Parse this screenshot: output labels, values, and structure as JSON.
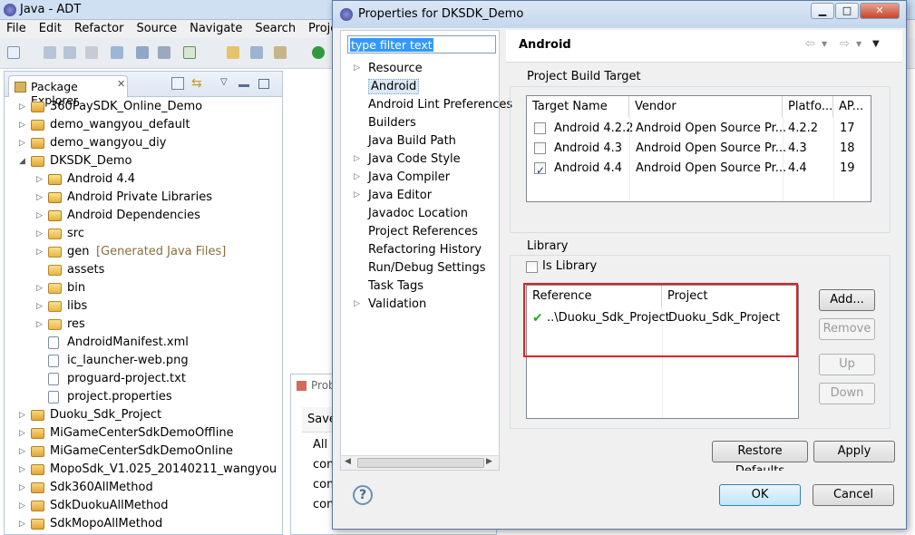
{
  "adt": {
    "title": "Java - ADT",
    "menu": [
      "File",
      "Edit",
      "Refactor",
      "Source",
      "Navigate",
      "Search",
      "Project"
    ],
    "package_explorer": {
      "tab_label": "Package Explorer",
      "items": [
        {
          "label": "360PaySDK_Online_Demo",
          "depth": 0,
          "expanded": false,
          "icon": "project-icon"
        },
        {
          "label": "demo_wangyou_default",
          "depth": 0,
          "expanded": false,
          "icon": "project-icon"
        },
        {
          "label": "demo_wangyou_diy",
          "depth": 0,
          "expanded": false,
          "icon": "project-icon"
        },
        {
          "label": "DKSDK_Demo",
          "depth": 0,
          "expanded": true,
          "icon": "project-icon"
        },
        {
          "label": "Android 4.4",
          "depth": 1,
          "expanded": false,
          "icon": "library-icon"
        },
        {
          "label": "Android Private Libraries",
          "depth": 1,
          "expanded": false,
          "icon": "library-icon"
        },
        {
          "label": "Android Dependencies",
          "depth": 1,
          "expanded": false,
          "icon": "library-icon"
        },
        {
          "label": "src",
          "depth": 1,
          "expanded": false,
          "icon": "folder-icon"
        },
        {
          "label": "gen",
          "suffix": "[Generated Java Files]",
          "depth": 1,
          "expanded": false,
          "icon": "folder-icon"
        },
        {
          "label": "assets",
          "depth": 1,
          "leaf": true,
          "icon": "folder-icon"
        },
        {
          "label": "bin",
          "depth": 1,
          "expanded": false,
          "icon": "folder-icon"
        },
        {
          "label": "libs",
          "depth": 1,
          "expanded": false,
          "icon": "folder-icon"
        },
        {
          "label": "res",
          "depth": 1,
          "expanded": false,
          "icon": "folder-icon"
        },
        {
          "label": "AndroidManifest.xml",
          "depth": 1,
          "leaf": true,
          "icon": "file-icon"
        },
        {
          "label": "ic_launcher-web.png",
          "depth": 1,
          "leaf": true,
          "icon": "file-icon"
        },
        {
          "label": "proguard-project.txt",
          "depth": 1,
          "leaf": true,
          "icon": "file-icon"
        },
        {
          "label": "project.properties",
          "depth": 1,
          "leaf": true,
          "icon": "file-icon"
        },
        {
          "label": "Duoku_Sdk_Project",
          "depth": 0,
          "expanded": false,
          "icon": "project-icon"
        },
        {
          "label": "MiGameCenterSdkDemoOffline",
          "depth": 0,
          "expanded": false,
          "icon": "project-icon"
        },
        {
          "label": "MiGameCenterSdkDemoOnline",
          "depth": 0,
          "expanded": false,
          "icon": "project-icon"
        },
        {
          "label": "MopoSdk_V1.025_20140211_wangyou",
          "depth": 0,
          "expanded": false,
          "icon": "project-icon"
        },
        {
          "label": "Sdk360AllMethod",
          "depth": 0,
          "expanded": false,
          "icon": "project-icon"
        },
        {
          "label": "SdkDuokuAllMethod",
          "depth": 0,
          "expanded": false,
          "icon": "project-icon"
        },
        {
          "label": "SdkMopoAllMethod",
          "depth": 0,
          "expanded": false,
          "icon": "project-icon"
        }
      ]
    },
    "mid_panel": {
      "tab": "Prob",
      "head": "Save",
      "rows": [
        "All r",
        "com",
        "com",
        "com"
      ]
    }
  },
  "dialog": {
    "title": "Properties for DKSDK_Demo",
    "filter_placeholder": "type filter text",
    "nav": [
      {
        "label": "Resource",
        "expandable": true
      },
      {
        "label": "Android",
        "selected": true
      },
      {
        "label": "Android Lint Preferences"
      },
      {
        "label": "Builders"
      },
      {
        "label": "Java Build Path"
      },
      {
        "label": "Java Code Style",
        "expandable": true
      },
      {
        "label": "Java Compiler",
        "expandable": true
      },
      {
        "label": "Java Editor",
        "expandable": true
      },
      {
        "label": "Javadoc Location"
      },
      {
        "label": "Project References"
      },
      {
        "label": "Refactoring History"
      },
      {
        "label": "Run/Debug Settings"
      },
      {
        "label": "Task Tags"
      },
      {
        "label": "Validation",
        "expandable": true
      }
    ],
    "page_title": "Android",
    "build_target": {
      "group_label": "Project Build Target",
      "headers": [
        "Target Name",
        "Vendor",
        "Platfo...",
        "AP..."
      ],
      "rows": [
        {
          "name": "Android 4.2.2",
          "vendor": "Android Open Source Pr...",
          "platform": "4.2.2",
          "api": "17",
          "checked": false
        },
        {
          "name": "Android 4.3",
          "vendor": "Android Open Source Pr...",
          "platform": "4.3",
          "api": "18",
          "checked": false
        },
        {
          "name": "Android 4.4",
          "vendor": "Android Open Source Pr...",
          "platform": "4.4",
          "api": "19",
          "checked": true
        }
      ]
    },
    "library": {
      "group_label": "Library",
      "is_library_label": "Is Library",
      "is_library_checked": false,
      "headers": [
        "Reference",
        "Project"
      ],
      "rows": [
        {
          "reference": "..\\Duoku_Sdk_Project",
          "project": "Duoku_Sdk_Project",
          "status": "ok"
        }
      ],
      "buttons": {
        "add": "Add...",
        "remove": "Remove",
        "up": "Up",
        "down": "Down"
      }
    },
    "restore_defaults": "Restore Defaults",
    "apply": "Apply",
    "ok": "OK",
    "cancel": "Cancel",
    "help_glyph": "?"
  },
  "colors": {
    "highlight": "#e02020",
    "check_green": "#2ca82c",
    "selection": "#3399ff"
  }
}
